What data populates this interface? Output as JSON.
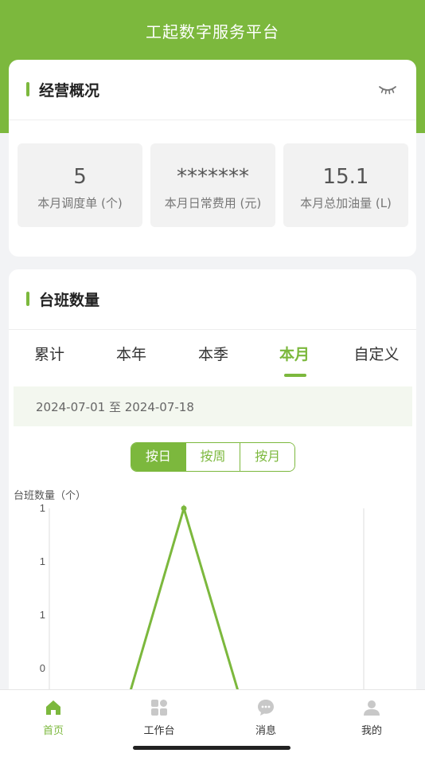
{
  "app": {
    "title": "工起数字服务平台"
  },
  "overview": {
    "title": "经营概况",
    "stats": [
      {
        "value": "5",
        "label": "本月调度单 (个)"
      },
      {
        "value": "*******",
        "label": "本月日常费用 (元)"
      },
      {
        "value": "15.1",
        "label": "本月总加油量 (L)"
      }
    ]
  },
  "shifts": {
    "title": "台班数量",
    "tabs": [
      "累计",
      "本年",
      "本季",
      "本月",
      "自定义"
    ],
    "active_tab": "本月",
    "date_range": "2024-07-01 至 2024-07-18",
    "segments": [
      "按日",
      "按周",
      "按月"
    ],
    "active_segment": "按日"
  },
  "chart_data": {
    "type": "line",
    "ylabel": "台班数量（个）",
    "y_tick_labels": [
      "1",
      "1",
      "1",
      "0"
    ],
    "series": [
      {
        "values": [
          0,
          1,
          0
        ]
      }
    ],
    "line_color": "#7cb83d"
  },
  "tabbar": {
    "items": [
      {
        "label": "首页",
        "icon": "home-icon",
        "active": true
      },
      {
        "label": "工作台",
        "icon": "workbench-icon",
        "active": false
      },
      {
        "label": "消息",
        "icon": "message-icon",
        "active": false
      },
      {
        "label": "我的",
        "icon": "profile-icon",
        "active": false
      }
    ],
    "accent": "#7cb83d"
  }
}
